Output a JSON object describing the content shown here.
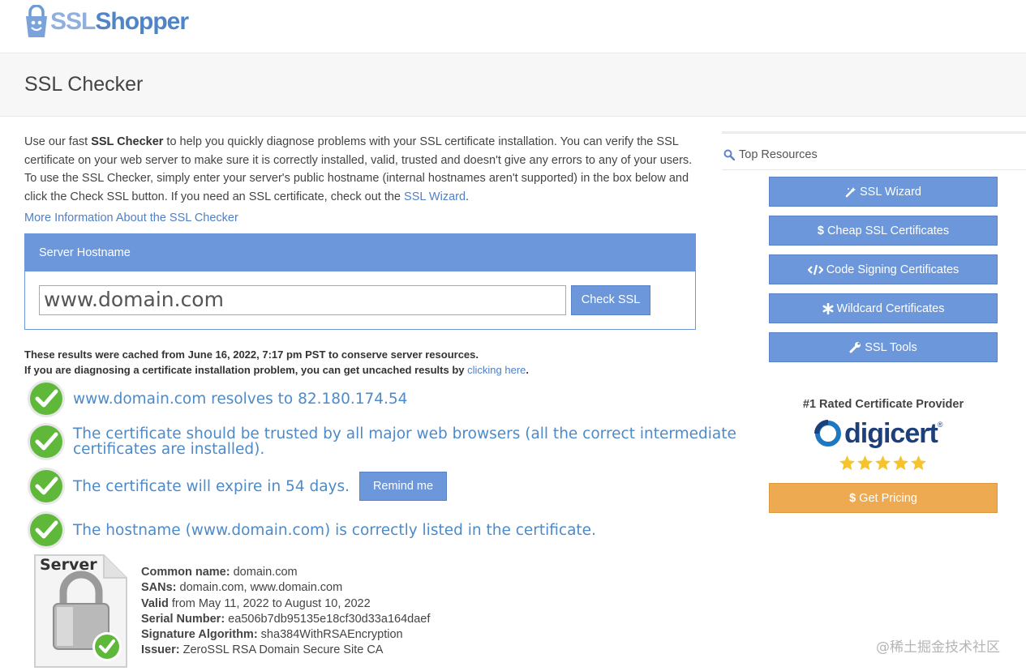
{
  "header": {
    "logo_ssl": "SSL",
    "logo_shopper": "Shopper"
  },
  "page": {
    "title": "SSL Checker"
  },
  "intro": {
    "p1": "Use our fast ",
    "bold": "SSL Checker",
    "p2": " to help you quickly diagnose problems with your SSL certificate installation. You can verify the SSL certificate on your web server to make sure it is correctly installed, valid, trusted and doesn't give any errors to any of your users. To use the SSL Checker, simply enter your server's public hostname (internal hostnames aren't supported) in the box below and click the Check SSL button. If you need an SSL certificate, check out the ",
    "link": "SSL Wizard",
    "p3": "."
  },
  "more_info_link": "More Information About the SSL Checker",
  "form": {
    "heading": "Server Hostname",
    "hostname_value": "www.domain.com",
    "button": "Check SSL"
  },
  "cached": {
    "line1": "These results were cached from June 16, 2022, 7:17 pm PST to conserve server resources.",
    "line2_prefix": "If you are diagnosing a certificate installation problem, you can get uncached results by ",
    "line2_link": "clicking here",
    "line2_suffix": "."
  },
  "results": {
    "r1": "www.domain.com resolves to 82.180.174.54",
    "r2a": "The certificate should be trusted by all major web browsers (all the correct intermediate",
    "r2b": "certificates are installed).",
    "r3": "The certificate will expire in 54 days.",
    "remind": "Remind me",
    "r4": "The hostname (www.domain.com) is correctly listed in the certificate."
  },
  "server_label": "Server",
  "details": {
    "common_name_label": "Common name:",
    "common_name": " domain.com",
    "sans_label": "SANs:",
    "sans": " domain.com, www.domain.com",
    "valid_label": "Valid",
    "valid": " from May 11, 2022 to August 10, 2022",
    "serial_label": "Serial Number:",
    "serial": " ea506b7db95135e18cf30d33a164daef",
    "sigalg_label": "Signature Algorithm:",
    "sigalg": " sha384WithRSAEncryption",
    "issuer_label": "Issuer:",
    "issuer": " ZeroSSL RSA Domain Secure Site CA"
  },
  "sidebar": {
    "heading": "Top Resources",
    "buttons": [
      {
        "label": "SSL Wizard",
        "icon": "magic-wand-icon"
      },
      {
        "label": "Cheap SSL Certificates",
        "icon": "dollar-icon"
      },
      {
        "label": "Code Signing Certificates",
        "icon": "code-icon"
      },
      {
        "label": "Wildcard Certificates",
        "icon": "asterisk-icon"
      },
      {
        "label": "SSL Tools",
        "icon": "wrench-icon"
      }
    ],
    "rated": "#1 Rated Certificate Provider",
    "digicert": "digicert",
    "digicert_reg": "®",
    "pricing": "Get Pricing",
    "rating_stars": 5
  },
  "watermark": "@稀土掘金技术社区",
  "colors": {
    "accent_blue": "#6c97db",
    "result_text": "#4c8ac9",
    "link": "#4f7fc6",
    "pricing_orange": "#eeaa50",
    "check_green": "#5fb83a"
  }
}
